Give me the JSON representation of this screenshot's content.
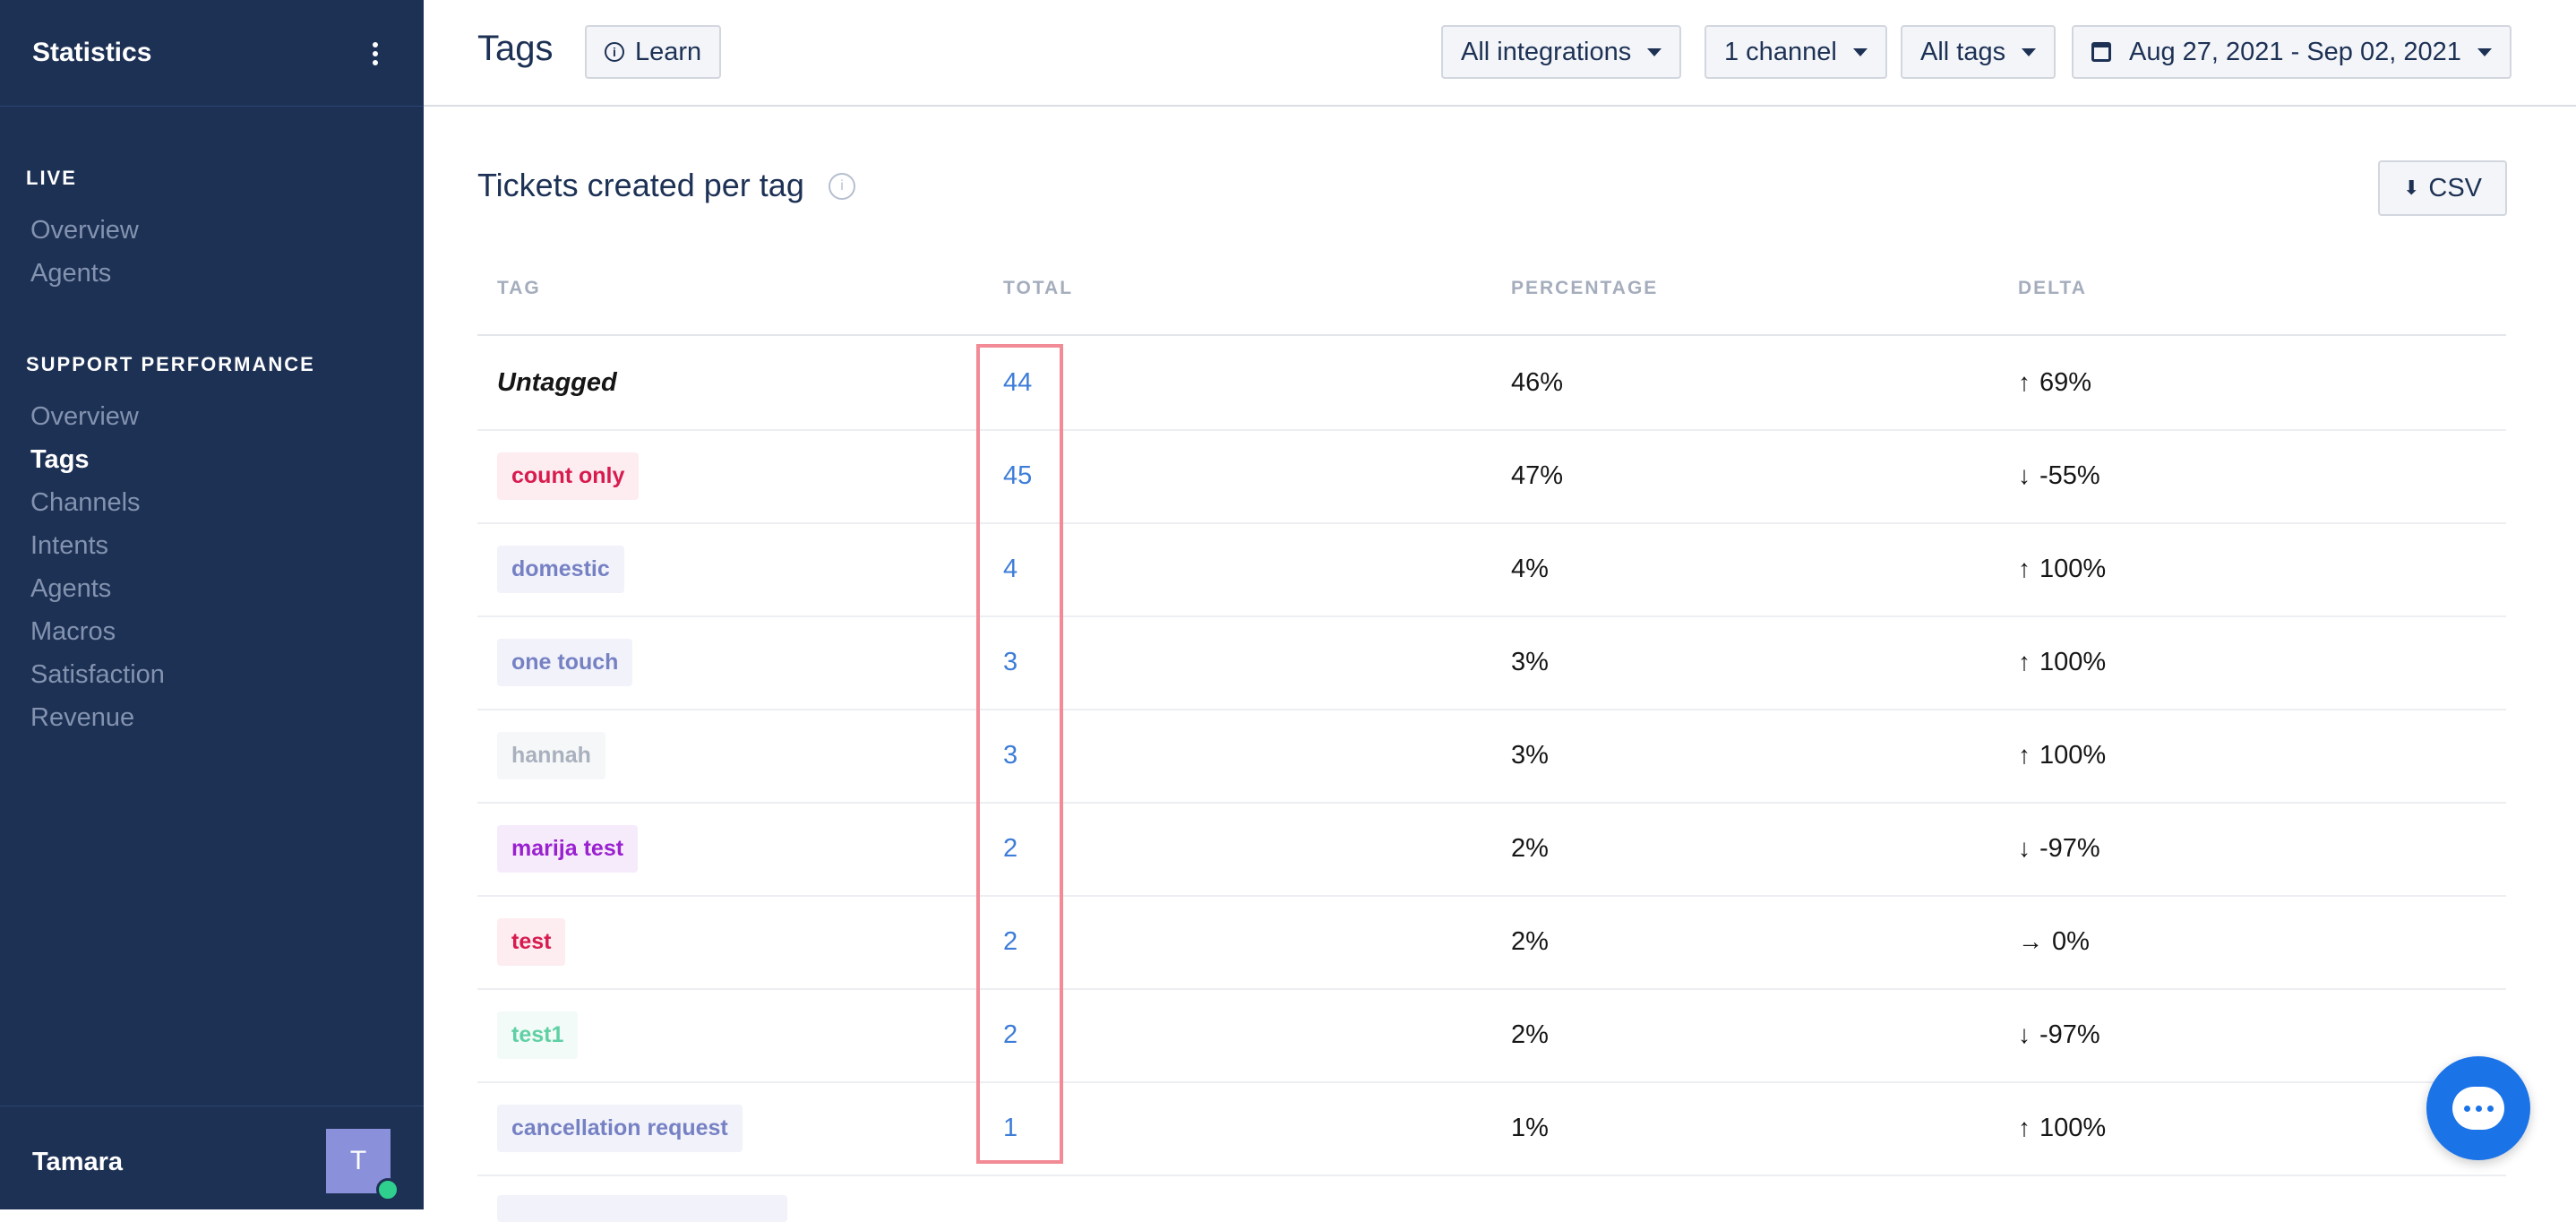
{
  "sidebar": {
    "title": "Statistics",
    "sections": [
      {
        "label": "LIVE",
        "items": [
          {
            "label": "Overview"
          },
          {
            "label": "Agents"
          }
        ]
      },
      {
        "label": "SUPPORT PERFORMANCE",
        "items": [
          {
            "label": "Overview"
          },
          {
            "label": "Tags"
          },
          {
            "label": "Channels"
          },
          {
            "label": "Intents"
          },
          {
            "label": "Agents"
          },
          {
            "label": "Macros"
          },
          {
            "label": "Satisfaction"
          },
          {
            "label": "Revenue"
          }
        ]
      }
    ],
    "active_item": "Tags",
    "user": {
      "name": "Tamara",
      "avatar_initial": "T",
      "status_color": "#2fd08e"
    }
  },
  "header": {
    "title": "Tags",
    "learn_label": "Learn",
    "filters": {
      "integrations": "All integrations",
      "channel": "1 channel",
      "tags": "All tags",
      "date_range": "Aug 27, 2021 - Sep 02, 2021"
    }
  },
  "card": {
    "title": "Tickets created per tag",
    "csv_label": "CSV",
    "columns": [
      "TAG",
      "TOTAL",
      "PERCENTAGE",
      "DELTA"
    ],
    "rows": [
      {
        "tag": "Untagged",
        "style": "plain",
        "total": "44",
        "percentage": "46%",
        "delta": "69%",
        "direction": "up"
      },
      {
        "tag": "count only",
        "style": "chip",
        "fg": "#d81b4f",
        "bg": "#fdecf0",
        "total": "45",
        "percentage": "47%",
        "delta": "-55%",
        "direction": "down"
      },
      {
        "tag": "domestic",
        "style": "chip",
        "fg": "#7681c4",
        "bg": "#f1f2fa",
        "total": "4",
        "percentage": "4%",
        "delta": "100%",
        "direction": "up"
      },
      {
        "tag": "one touch",
        "style": "chip",
        "fg": "#7681c4",
        "bg": "#f1f2fa",
        "total": "3",
        "percentage": "3%",
        "delta": "100%",
        "direction": "up"
      },
      {
        "tag": "hannah",
        "style": "chip",
        "fg": "#a9b1be",
        "bg": "#f6f7f9",
        "total": "3",
        "percentage": "3%",
        "delta": "100%",
        "direction": "up"
      },
      {
        "tag": "marija test",
        "style": "chip",
        "fg": "#9a21d0",
        "bg": "#f6ebfb",
        "total": "2",
        "percentage": "2%",
        "delta": "-97%",
        "direction": "down"
      },
      {
        "tag": "test",
        "style": "chip",
        "fg": "#d81b4f",
        "bg": "#fdecf0",
        "total": "2",
        "percentage": "2%",
        "delta": "0%",
        "direction": "right"
      },
      {
        "tag": "test1",
        "style": "chip",
        "fg": "#5fd0a4",
        "bg": "#f2fbf7",
        "total": "2",
        "percentage": "2%",
        "delta": "-97%",
        "direction": "down"
      },
      {
        "tag": "cancellation request",
        "style": "chip",
        "fg": "#7681c4",
        "bg": "#f1f2fa",
        "total": "1",
        "percentage": "1%",
        "delta": "100%",
        "direction": "up"
      }
    ]
  },
  "colors": {
    "sidebar_bg": "#1d3155",
    "accent": "#3d7dd8",
    "highlight": "#f28b96",
    "chat": "#1b73e8"
  }
}
